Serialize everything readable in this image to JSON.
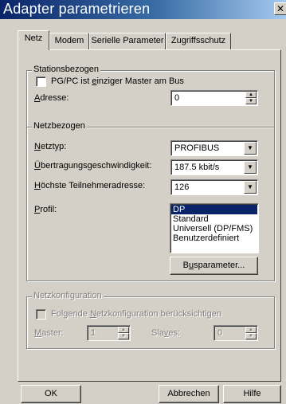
{
  "window": {
    "title": "Adapter parametrieren",
    "close_glyph": "✕"
  },
  "tabs": [
    {
      "label": "Netz",
      "active": true
    },
    {
      "label": "Modem",
      "active": false
    },
    {
      "label": "Serielle Parameter",
      "active": false
    },
    {
      "label": "Zugriffsschutz",
      "active": false
    }
  ],
  "stationsbezogen": {
    "legend": "Stationsbezogen",
    "single_master": {
      "pre": "PG/PC ist ",
      "accel": "e",
      "post": "inziger Master am Bus",
      "checked": false
    },
    "adresse": {
      "accel": "A",
      "rest": "dresse:",
      "value": "0"
    }
  },
  "netzbezogen": {
    "legend": "Netzbezogen",
    "netztyp": {
      "accel": "N",
      "rest": "etztyp:",
      "value": "PROFIBUS"
    },
    "rate": {
      "accel": "Ü",
      "rest": "bertragungsgeschwindigkeit:",
      "value": "187.5 kbit/s"
    },
    "max_addr": {
      "accel": "H",
      "rest": "öchste Teilnehmeradresse:",
      "value": "126"
    },
    "profil": {
      "accel": "P",
      "rest": "rofil:",
      "options": [
        "DP",
        "Standard",
        "Universell (DP/FMS)",
        "Benutzerdefiniert"
      ],
      "selected": "DP"
    },
    "busparameter_button": {
      "pre": "B",
      "accel": "u",
      "post": "sparameter..."
    }
  },
  "netzkonfiguration": {
    "legend": "Netzkonfiguration",
    "checkbox": {
      "pre": "Folgende ",
      "accel": "N",
      "post": "etzkonfiguration berücksichtigen",
      "checked": false
    },
    "master": {
      "accel": "M",
      "rest": "aster:",
      "value": "1"
    },
    "slaves": {
      "pre": "Sla",
      "accel": "v",
      "post": "es:",
      "value": "0"
    }
  },
  "footer": {
    "ok": "OK",
    "cancel": "Abbrechen",
    "help": "Hilfe"
  },
  "colors": {
    "titlebar_start": "#0a246a",
    "titlebar_end": "#a6caf0",
    "face": "#d4d0c8",
    "selection": "#0a246a"
  }
}
